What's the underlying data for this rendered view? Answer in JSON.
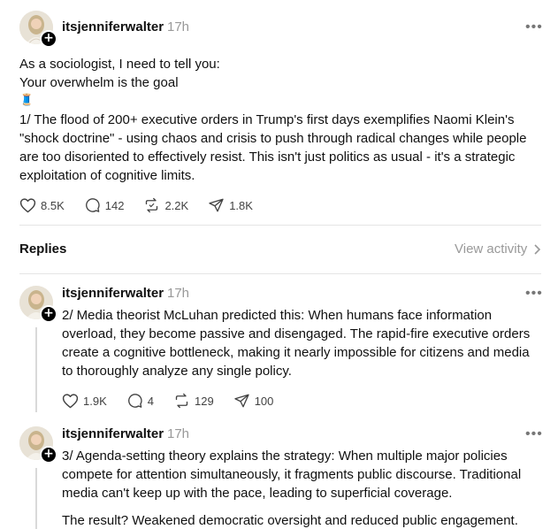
{
  "main_post": {
    "username": "itsjenniferwalter",
    "time": "17h",
    "lines": [
      "As a sociologist, I need to tell you:",
      "Your overwhelm is the goal",
      "1/ The flood of 200+ executive orders in Trump's first days exemplifies Naomi Klein's",
      "\"shock doctrine\" - using chaos and crisis to push through radical changes while people",
      "are too disoriented to effectively resist. This isn't just politics as usual - it's a strategic",
      "exploitation of cognitive limits."
    ],
    "emoji": "🧵",
    "likes": "8.5K",
    "comments": "142",
    "reposts": "2.2K",
    "shares": "1.8K"
  },
  "replies_header": {
    "title": "Replies",
    "view_activity": "View activity"
  },
  "replies": [
    {
      "username": "itsjenniferwalter",
      "time": "17h",
      "lines": [
        "2/ Media theorist McLuhan predicted this: When humans face information",
        "overload, they become passive and disengaged. The rapid-fire executive orders",
        "create a cognitive bottleneck, making it nearly impossible for citizens and media",
        "to thoroughly analyze any single policy."
      ],
      "likes": "1.9K",
      "comments": "4",
      "reposts": "129",
      "shares": "100"
    },
    {
      "username": "itsjenniferwalter",
      "time": "17h",
      "lines": [
        "3/ Agenda-setting theory explains the strategy: When multiple major policies",
        "compete for attention simultaneously, it fragments public discourse. Traditional",
        "media can't keep up with the pace, leading to superficial coverage."
      ],
      "extra_line": "The result? Weakened democratic oversight and reduced public engagement."
    }
  ],
  "icons": {
    "more": "more-horizontal-icon",
    "like": "heart-icon",
    "comment": "comment-bubble-icon",
    "repost": "repost-icon",
    "share": "send-icon",
    "follow": "plus-icon",
    "chevron": "chevron-right-icon"
  },
  "colors": {
    "text": "#101010",
    "muted": "#999999",
    "divider": "#e5e5e5"
  }
}
